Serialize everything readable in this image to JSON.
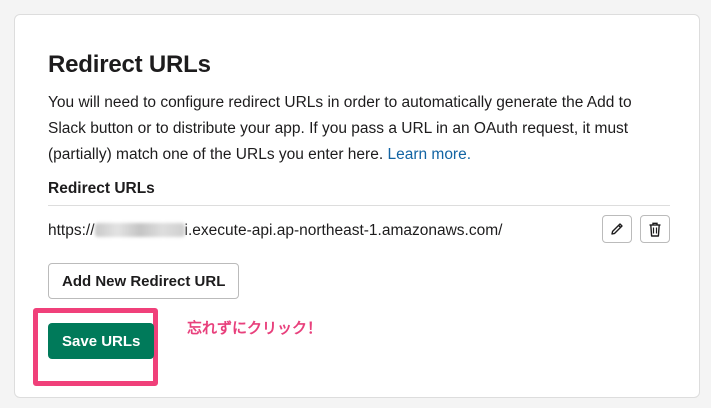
{
  "section": {
    "title": "Redirect URLs",
    "description": "You will need to configure redirect URLs in order to automatically generate the Add to Slack button or to distribute your app. If you pass a URL in an OAuth request, it must (partially) match one of the URLs you enter here.",
    "learn_more_label": "Learn more."
  },
  "redirect_urls": {
    "label": "Redirect URLs",
    "items": [
      {
        "url_prefix": "https://",
        "url_suffix": "i.execute-api.ap-northeast-1.amazonaws.com/",
        "edit_icon": "pencil-icon",
        "delete_icon": "trash-icon"
      }
    ],
    "add_button_label": "Add New Redirect URL"
  },
  "actions": {
    "save_button_label": "Save URLs"
  },
  "annotation": {
    "text": "忘れずにクリック！",
    "color": "#e8407c",
    "highlight_color": "#f0407a"
  },
  "colors": {
    "link": "#1264a3",
    "save_button": "#007a5a"
  }
}
